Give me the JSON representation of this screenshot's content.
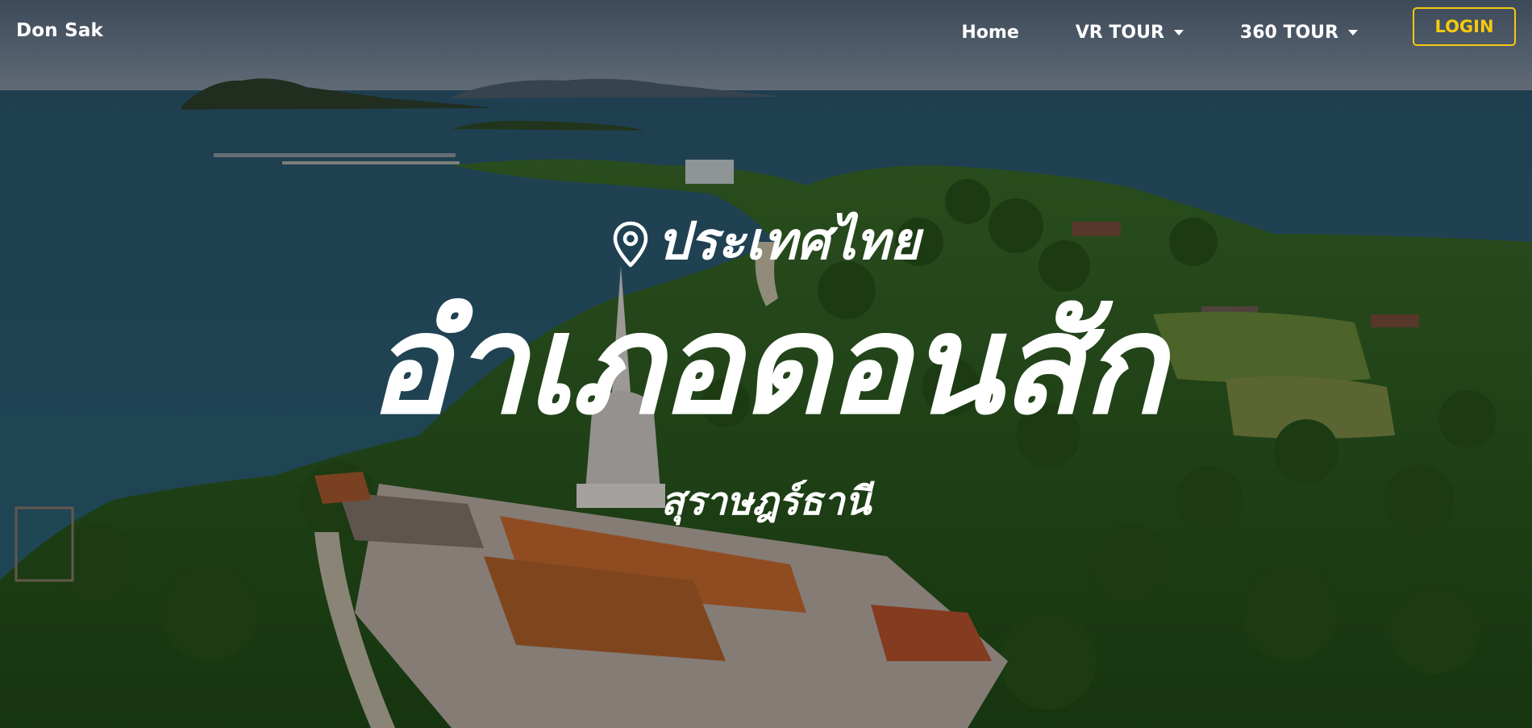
{
  "navbar": {
    "brand": "Don Sak",
    "links": [
      {
        "label": "Home",
        "dropdown": false
      },
      {
        "label": "VR TOUR",
        "dropdown": true
      },
      {
        "label": "360 TOUR",
        "dropdown": true
      }
    ],
    "login_label": "LOGIN"
  },
  "hero": {
    "country": "ประเทศไทย",
    "district": "อำเภอดอนสัก",
    "province": "สุราษฎร์ธานี",
    "location_icon": "map-pin-icon"
  },
  "colors": {
    "accent": "#f6c90e",
    "text": "#ffffff",
    "sea": "#2c5a72",
    "forest": "#2f5a23",
    "roof": "#c86a2e"
  }
}
